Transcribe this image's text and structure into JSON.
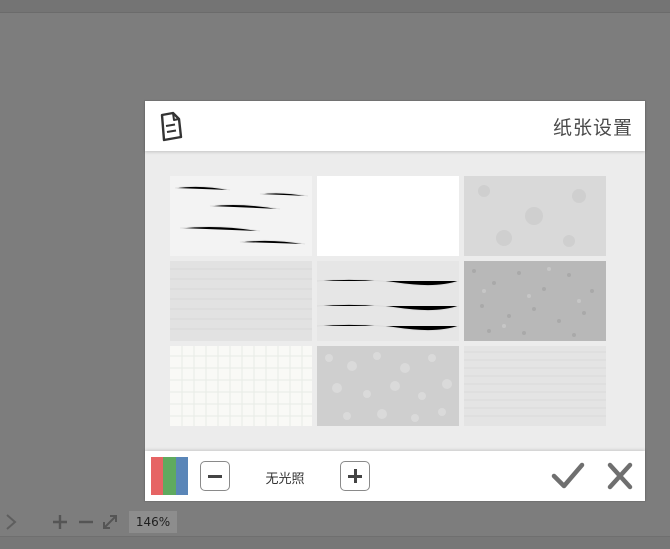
{
  "dialog": {
    "title": "纸张设置",
    "icon": "document-icon",
    "textures": [
      {
        "name": "white-fiber-paper",
        "color": "#f3f3f3",
        "pattern": "fiber"
      },
      {
        "name": "plain-white-paper",
        "color": "#ffffff",
        "pattern": "plain"
      },
      {
        "name": "light-gray-paper",
        "color": "#d9d9d9",
        "pattern": "mottled"
      },
      {
        "name": "gray-lined-paper",
        "color": "#e2e2e2",
        "pattern": "lines"
      },
      {
        "name": "light-grain-paper",
        "color": "#e6e6e6",
        "pattern": "grain"
      },
      {
        "name": "dark-rough-paper",
        "color": "#b8b8b8",
        "pattern": "rough"
      },
      {
        "name": "grid-paper",
        "color": "#f9f9f6",
        "pattern": "grid"
      },
      {
        "name": "pebbled-paper",
        "color": "#cfcfcf",
        "pattern": "pebble"
      },
      {
        "name": "canvas-paper",
        "color": "#e4e4e4",
        "pattern": "canvas"
      }
    ],
    "footer": {
      "swatch_colors": [
        "#e66464",
        "#5faa5f",
        "#5a86b8"
      ],
      "light_label": "无光照",
      "decrease_icon": "minus-icon",
      "increase_icon": "plus-icon",
      "confirm_icon": "checkmark-icon",
      "cancel_icon": "x-icon"
    }
  },
  "statusbar": {
    "zoom": "146%"
  }
}
